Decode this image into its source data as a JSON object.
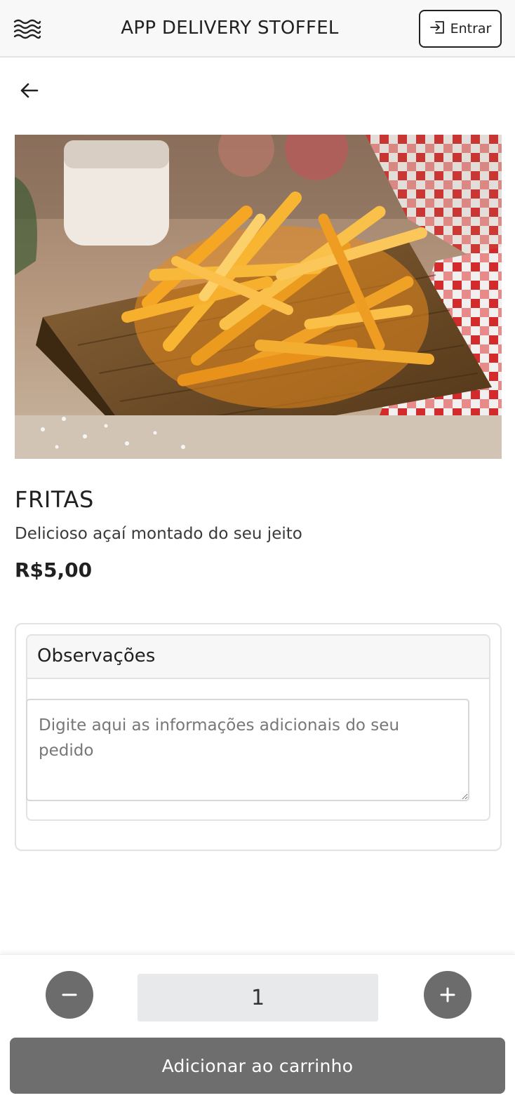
{
  "header": {
    "title": "APP DELIVERY STOFFEL",
    "login_label": "Entrar"
  },
  "product": {
    "image_alt": "Fritas",
    "name": "FRITAS",
    "description": "Delicioso açaí montado do seu jeito",
    "price": "R$5,00"
  },
  "notes": {
    "title": "Observações",
    "placeholder": "Digite aqui as informações adicionais do seu pedido",
    "value": ""
  },
  "cart": {
    "quantity": "1",
    "add_label": "Adicionar ao carrinho"
  },
  "colors": {
    "button_gray": "#6e6e6e",
    "qty_background": "#e8e9eb",
    "header_background": "#f8f8f8"
  }
}
